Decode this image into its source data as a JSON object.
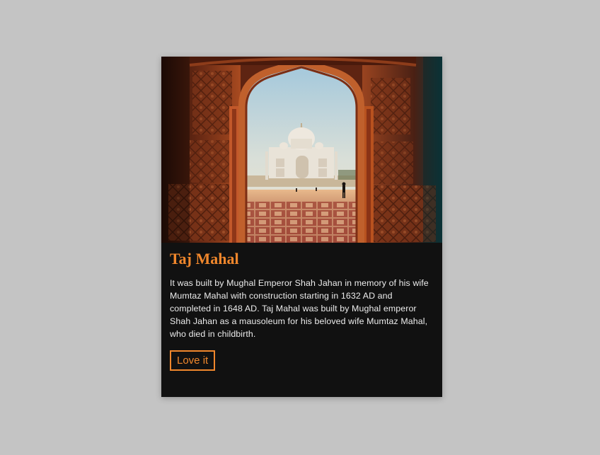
{
  "card": {
    "image_subject": "Taj Mahal viewed through a carved red sandstone archway",
    "title": "Taj Mahal",
    "description": "It was built by Mughal Emperor Shah Jahan in memory of his wife Mumtaz Mahal with construction starting in 1632 AD and completed in 1648 AD. Taj Mahal was built by Mughal emperor Shah Jahan as a mausoleum for his beloved wife Mumtaz Mahal, who died in childbirth.",
    "button_label": "Love it"
  },
  "colors": {
    "page_background": "#c4c4c4",
    "card_background": "#111111",
    "accent": "#f0872c",
    "text": "#ececec"
  }
}
